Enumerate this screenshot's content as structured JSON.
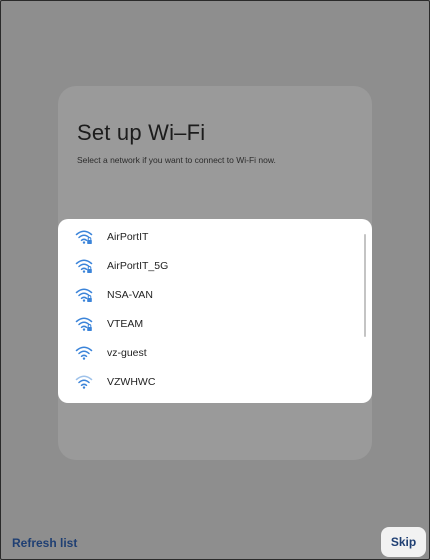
{
  "setup": {
    "title": "Set up Wi–Fi",
    "subtitle": "Select a network if you want to connect to Wi-Fi now."
  },
  "networks": [
    {
      "name": "AirPortIT",
      "icon": "wifi-lock-icon",
      "secured": true
    },
    {
      "name": "AirPortIT_5G",
      "icon": "wifi-lock-icon",
      "secured": true
    },
    {
      "name": "NSA-VAN",
      "icon": "wifi-lock-icon",
      "secured": true
    },
    {
      "name": "VTEAM",
      "icon": "wifi-lock-icon",
      "secured": true
    },
    {
      "name": "vz-guest",
      "icon": "wifi-icon",
      "secured": false
    },
    {
      "name": "VZWHWC",
      "icon": "wifi-icon",
      "secured": false
    }
  ],
  "footer": {
    "refresh_label": "Refresh list",
    "skip_label": "Skip"
  },
  "colors": {
    "overlay": "#8e8e8e",
    "wifi_icon": "#3b84d9",
    "button_text": "#1f3f73"
  }
}
